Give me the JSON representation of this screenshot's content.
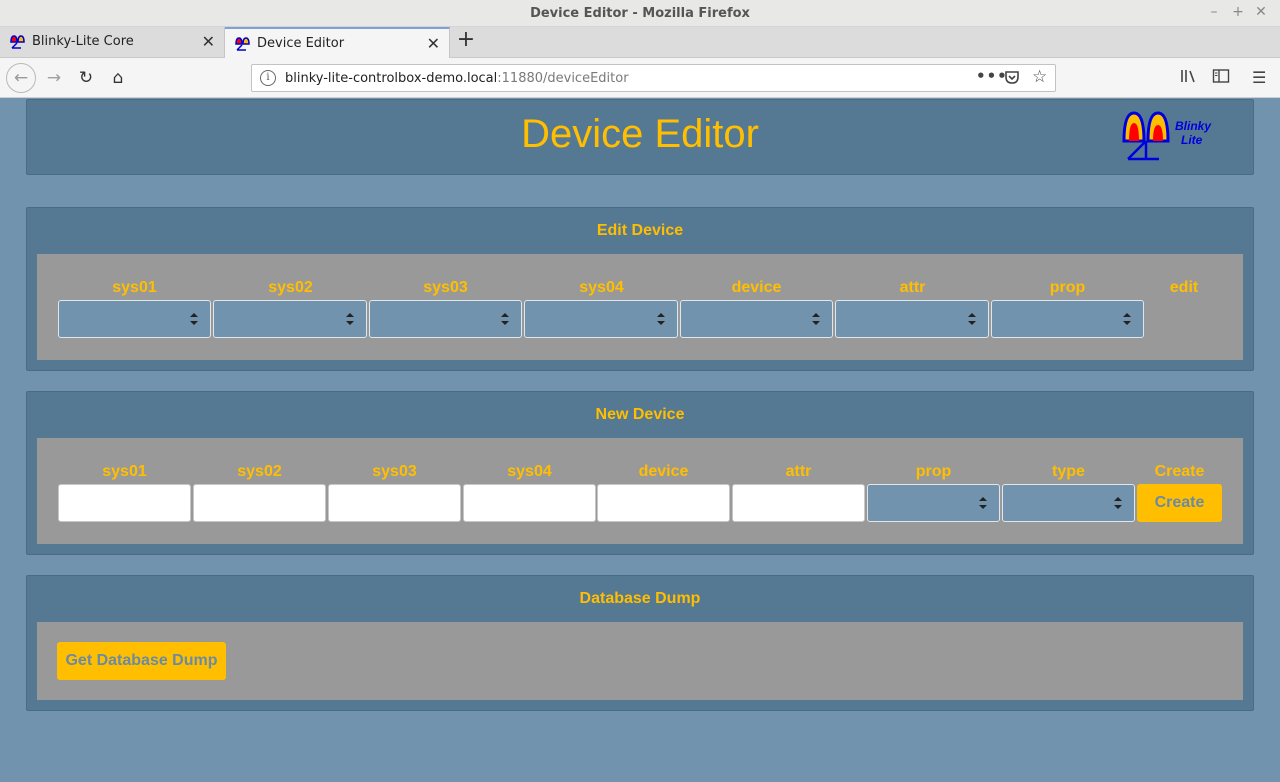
{
  "window": {
    "title": "Device Editor - Mozilla Firefox"
  },
  "tabs": [
    {
      "label": "Blinky-Lite Core",
      "active": false
    },
    {
      "label": "Device Editor",
      "active": true
    }
  ],
  "address": {
    "host": "blinky-lite-controlbox-demo.local",
    "port_path": ":11880/deviceEditor"
  },
  "page": {
    "title": "Device Editor",
    "logo_text": [
      "Blinky",
      "Lite"
    ]
  },
  "edit_device": {
    "title": "Edit Device",
    "columns": [
      "sys01",
      "sys02",
      "sys03",
      "sys04",
      "device",
      "attr",
      "prop",
      "edit"
    ]
  },
  "new_device": {
    "title": "New Device",
    "columns": [
      "sys01",
      "sys02",
      "sys03",
      "sys04",
      "device",
      "attr",
      "prop",
      "type",
      "Create"
    ],
    "create_button": "Create"
  },
  "database_dump": {
    "title": "Database Dump",
    "button": "Get Database Dump"
  },
  "colors": {
    "accent": "#ffbf00",
    "panel": "#557893",
    "page_bg": "#7293ad",
    "inner": "#999999"
  }
}
